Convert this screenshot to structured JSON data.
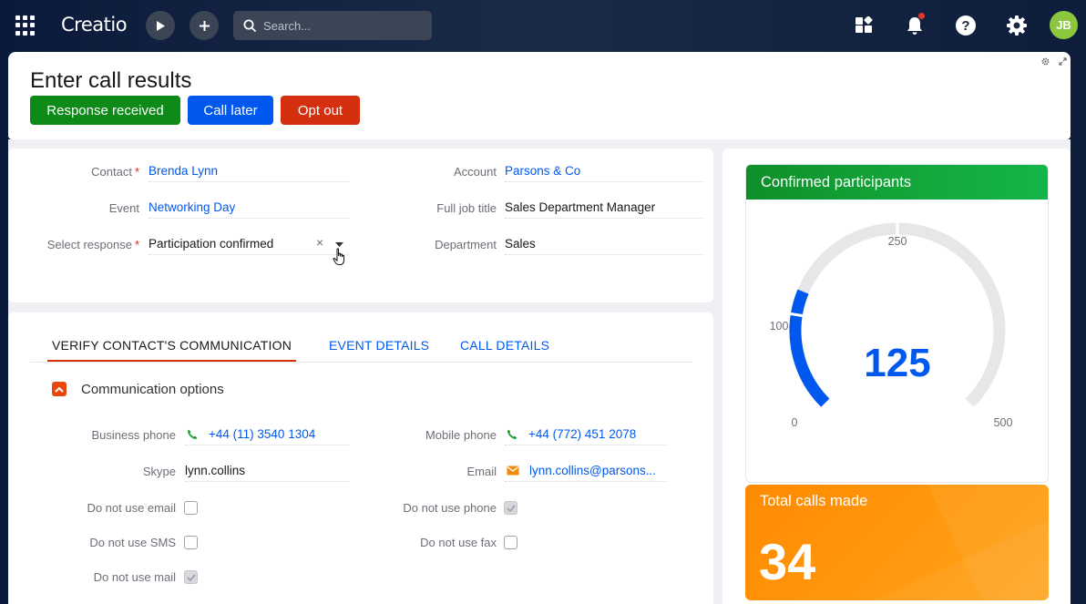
{
  "topbar": {
    "logo": "Creatio",
    "search_placeholder": "Search...",
    "avatar_initials": "JB"
  },
  "header": {
    "title": "Enter call results",
    "buttons": {
      "response_received": "Response received",
      "call_later": "Call later",
      "opt_out": "Opt out"
    }
  },
  "fields": {
    "contact_label": "Contact",
    "contact_value": "Brenda Lynn",
    "event_label": "Event",
    "event_value": "Networking Day",
    "response_label": "Select response",
    "response_value": "Participation confirmed",
    "clear_symbol": "×",
    "account_label": "Account",
    "account_value": "Parsons & Co",
    "job_title_label": "Full job title",
    "job_title_value": "Sales Department Manager",
    "department_label": "Department",
    "department_value": "Sales"
  },
  "tabs": {
    "verify": "VERIFY CONTACT'S COMMUNICATION",
    "event_details": "EVENT DETAILS",
    "call_details": "CALL DETAILS"
  },
  "communication": {
    "group_title": "Communication options",
    "business_phone_label": "Business phone",
    "business_phone_value": "+44 (11) 3540 1304",
    "mobile_phone_label": "Mobile phone",
    "mobile_phone_value": "+44 (772) 451 2078",
    "skype_label": "Skype",
    "skype_value": "lynn.collins",
    "email_label": "Email",
    "email_value": "lynn.collins@parsons...",
    "dnu_email_label": "Do not use email",
    "dnu_email_checked": false,
    "dnu_phone_label": "Do not use phone",
    "dnu_phone_checked": true,
    "dnu_sms_label": "Do not use SMS",
    "dnu_sms_checked": false,
    "dnu_fax_label": "Do not use fax",
    "dnu_fax_checked": false,
    "dnu_mail_label": "Do not use mail",
    "dnu_mail_checked": true
  },
  "widgets": {
    "gauge": {
      "title": "Confirmed participants",
      "value": "125",
      "min_label": "0",
      "low_label": "100",
      "mid_label": "250",
      "max_label": "500",
      "min": 0,
      "max": 500,
      "current": 125
    },
    "metric": {
      "title": "Total calls made",
      "value": "34"
    }
  },
  "colors": {
    "accent_blue": "#0058ef",
    "success_green": "#0d8a18",
    "danger_red": "#d4300f",
    "metric_orange": "#ff8a00"
  }
}
